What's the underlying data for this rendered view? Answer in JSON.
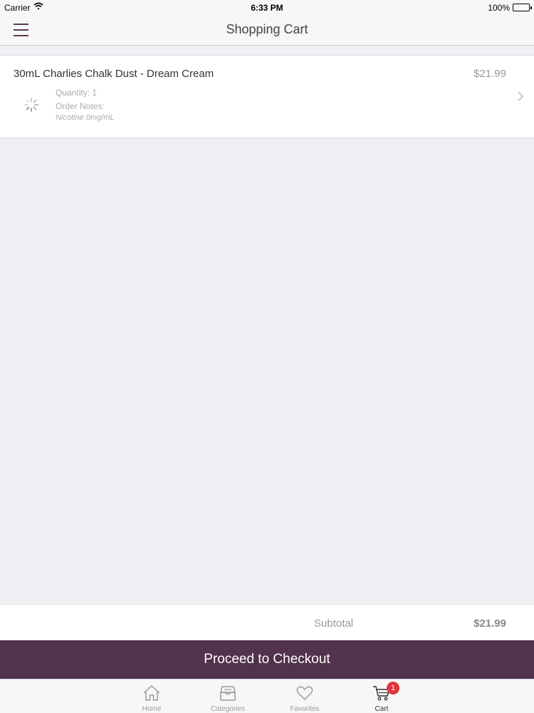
{
  "status_bar": {
    "carrier": "Carrier",
    "time": "6:33 PM",
    "battery": "100%"
  },
  "nav": {
    "title": "Shopping Cart",
    "menu_icon": "hamburger-menu-icon"
  },
  "cart": {
    "items": [
      {
        "name": "30mL Charlies Chalk Dust - Dream Cream",
        "price": "$21.99",
        "quantity": "Quantity: 1",
        "notes_label": "Order Notes:",
        "notes": "Nicotine 0mg/mL"
      }
    ]
  },
  "summary": {
    "subtotal_label": "Subtotal",
    "subtotal_value": "$21.99",
    "checkout_label": "Proceed to Checkout"
  },
  "tabs": [
    {
      "label": "Home",
      "icon": "home-icon"
    },
    {
      "label": "Categories",
      "icon": "categories-icon"
    },
    {
      "label": "Favorites",
      "icon": "heart-icon"
    },
    {
      "label": "Cart",
      "icon": "cart-icon",
      "badge": "1",
      "active": true
    }
  ],
  "colors": {
    "brand": "#52324d",
    "badge": "#e3343b",
    "background": "#efeff4"
  }
}
